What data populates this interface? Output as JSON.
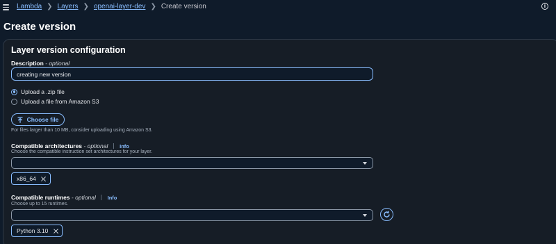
{
  "breadcrumb": {
    "items": [
      {
        "label": "Lambda"
      },
      {
        "label": "Layers"
      },
      {
        "label": "openai-layer-dev"
      }
    ],
    "current": "Create version"
  },
  "page": {
    "title": "Create version"
  },
  "panel": {
    "title": "Layer version configuration"
  },
  "description": {
    "label": "Description",
    "optional": "- optional",
    "value": "creating new version"
  },
  "upload": {
    "options": [
      {
        "label": "Upload a .zip file",
        "checked": true
      },
      {
        "label": "Upload a file from Amazon S3",
        "checked": false
      }
    ],
    "choose_button": "Choose file",
    "hint": "For files larger than 10 MB, consider uploading using Amazon S3."
  },
  "architectures": {
    "label": "Compatible architectures",
    "optional": "- optional",
    "info": "Info",
    "description": "Choose the compatible instruction set architectures for your layer.",
    "selected_value": "",
    "tokens": [
      "x86_64"
    ]
  },
  "runtimes": {
    "label": "Compatible runtimes",
    "optional": "- optional",
    "info": "Info",
    "description": "Choose up to 15 runtimes.",
    "selected_value": "",
    "tokens": [
      "Python 3.10"
    ]
  },
  "icons": {
    "menu": "hamburger-menu-icon",
    "help": "info-circle-icon",
    "upload": "upload-arrow-icon",
    "refresh": "refresh-icon",
    "dismiss": "close-icon",
    "dropdown": "caret-down-icon"
  },
  "colors": {
    "background": "#0f1b2a",
    "panel": "#161d26",
    "accent": "#89bdff",
    "text": "#ffffff"
  }
}
